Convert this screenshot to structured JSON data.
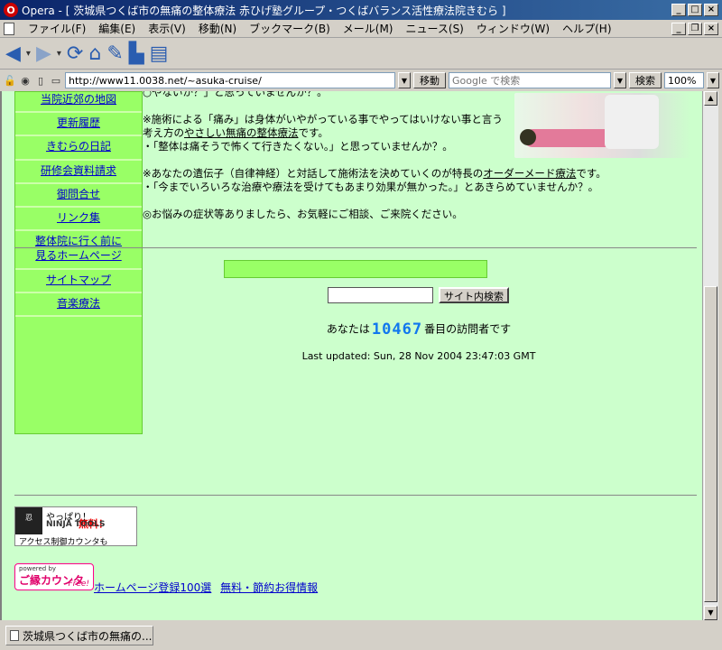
{
  "window": {
    "title": "Opera - [ 茨城県つくば市の無痛の整体療法 赤ひげ塾グループ・つくばバランス活性療法院きむら ]",
    "app_icon": "opera-icon"
  },
  "menu": [
    "ファイル(F)",
    "編集(E)",
    "表示(V)",
    "移動(N)",
    "ブックマーク(B)",
    "メール(M)",
    "ニュース(S)",
    "ウィンドウ(W)",
    "ヘルプ(H)"
  ],
  "address": {
    "url": "http://www11.0038.net/~asuka-cruise/",
    "go_label": "移動",
    "search_placeholder": "Google で検索",
    "search_label": "検索",
    "zoom": "100%"
  },
  "sidebar": {
    "items": [
      "当院近郊の地図",
      "更新履歴",
      "きむらの日記",
      "研修会資料請求",
      "御問合せ",
      "リンク集",
      "整体院に行く前に見るホームページ",
      "サイトマップ",
      "音楽療法"
    ]
  },
  "content": {
    "p0": "○やないか？」と思っていませんか？。",
    "p1_a": "※施術による「痛み」は身体がいやがっている事でやってはいけない事と言う考え方の",
    "p1_link": "やさしい無痛の整体療法",
    "p1_b": "です。",
    "p1_c": "・「整体は痛そうで怖くて行きたくない。」と思っていませんか？。",
    "p2_a": "※あなたの遺伝子（自律神経）と対話して施術法を決めていくのが特長の",
    "p2_link": "オーダーメード療法",
    "p2_b": "です。",
    "p2_c": "・「今までいろいろな治療や療法を受けてもあまり効果が無かった。」とあきらめていませんか？。",
    "p3": "◎お悩みの症状等ありましたら、お気軽にご相談、ご来院ください。"
  },
  "site_search": {
    "button": "サイト内検索"
  },
  "visitor": {
    "prefix": "あなたは",
    "count": "10467",
    "suffix": "番目の訪問者です"
  },
  "last_updated": "Last updated: Sun, 28 Nov 2004 23:47:03 GMT",
  "ninja": {
    "line1": "やっぱり！",
    "free": "無料！",
    "tools": "NINJA TOOLS",
    "line2": "アクセス制御カウンタも"
  },
  "counter_logo": {
    "powered": "powered by",
    "name": "ご縁カウンタ",
    "free": "Free!"
  },
  "bottom_links": [
    "ホームページ登録100選",
    "無料・節約お得情報"
  ],
  "status": {
    "tab_title": "茨城県つくば市の無痛の..."
  }
}
